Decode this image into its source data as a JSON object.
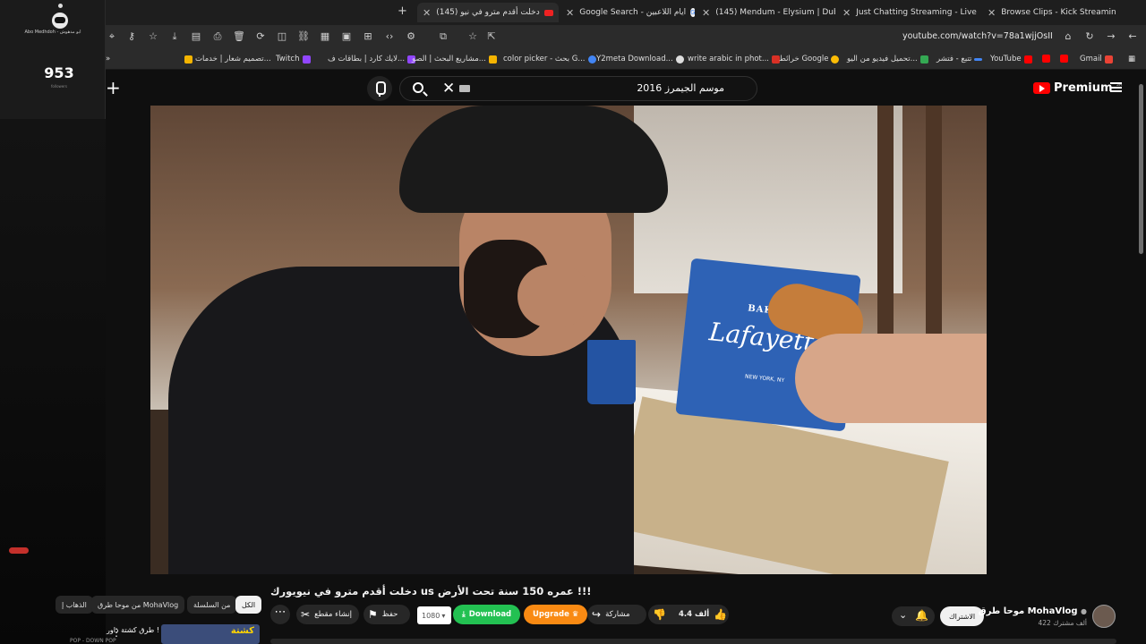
{
  "stream_widget": {
    "name": "Abo Medhdoh - ابو مدهوش",
    "viewer_count": "953",
    "sub_label": "followers"
  },
  "tabs": [
    {
      "label": "Browse Clips - Kick Streaming",
      "icon": "kick-icon"
    },
    {
      "label": "Just Chatting Streaming - Live",
      "icon": "kick-icon"
    },
    {
      "label": "(145) Mendum - Elysium | Dub",
      "icon": "youtube-icon"
    },
    {
      "label": "Google Search - ايام اللاعبين",
      "icon": "google-icon"
    },
    {
      "label": "(145) دخلت أقدم مترو في نيو",
      "icon": "youtube-icon",
      "active": true
    }
  ],
  "toolbar": {
    "url": "youtube.com/watch?v=78a1wjjOsII"
  },
  "bookmarks": [
    {
      "label": "Gmail",
      "color": "#ea4335"
    },
    {
      "label": "",
      "color": "#ff0000"
    },
    {
      "label": "",
      "color": "#ff0000"
    },
    {
      "label": "YouTube",
      "color": "#ff0000"
    },
    {
      "label": "تتبع - فتشر",
      "color": "#4285f4"
    },
    {
      "label": "تحميل فيديو من اليو...",
      "color": "#34a853"
    },
    {
      "label": "خرائط Google",
      "color": "#fbbc05"
    },
    {
      "label": "write arabic in phot...",
      "color": "#d93025"
    },
    {
      "label": "Y2meta Download...",
      "color": "#dddddd"
    },
    {
      "label": "color picker - بحث G...",
      "color": "#4285f4"
    },
    {
      "label": "مشاريع البحث | الصو...",
      "color": "#f4b400"
    },
    {
      "label": "لايك كارد | بطاقات ف...",
      "color": "#9146ff"
    },
    {
      "label": "Twitch",
      "color": "#9146ff"
    },
    {
      "label": "تصميم شعار | خدمات...",
      "color": "#f4b400"
    }
  ],
  "search": {
    "value": "موسم الجيمرز 2016"
  },
  "logo": {
    "text": "Premium",
    "country": "SA"
  },
  "video": {
    "bag_top": "BAKERY",
    "bag_brand": "Lafayette",
    "bag_city": "NEW YORK, NY"
  },
  "video_title": "دخلت أقدم مترو في نيويورك us عمره 150 سنة تحت الأرض !!!",
  "chips": [
    {
      "label": "الكل",
      "active": true
    },
    {
      "label": "من السلسلة"
    },
    {
      "label": "من موحا طرق MohaVlog"
    },
    {
      "label": "الذهاب إ"
    }
  ],
  "actions": {
    "like_count": "4.4 ألف",
    "share": "مشاركة",
    "upgrade": "Upgrade",
    "download": "Download",
    "quality": "1080",
    "save": "حفظ",
    "clip": "إنشاء مقطع"
  },
  "channel": {
    "name": "موحا طرق MohaVlog",
    "subscribers": "422 ألف مشترك",
    "subscribe_label": "الاشتراك"
  },
  "recommendation": {
    "title": "طرق كشتة داور !",
    "thumb_text": "كشتة",
    "meta": "POP - DOWN POP"
  }
}
